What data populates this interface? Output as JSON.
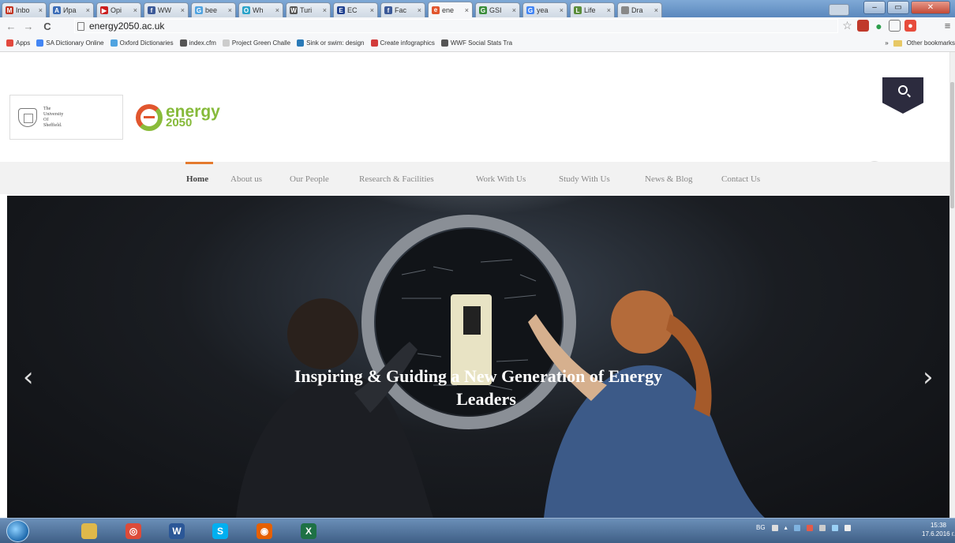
{
  "browser": {
    "tabs": [
      {
        "label": "Inbo",
        "color": "#c23321",
        "glyph": "M"
      },
      {
        "label": "Ира",
        "color": "#3b6cb7",
        "glyph": "A"
      },
      {
        "label": "Opi",
        "color": "#cc1e1e",
        "glyph": "▶"
      },
      {
        "label": "WW",
        "color": "#3b5998",
        "glyph": "f"
      },
      {
        "label": "bee",
        "color": "#4fa3e0",
        "glyph": "G"
      },
      {
        "label": "Wh",
        "color": "#2aa3c9",
        "glyph": "O"
      },
      {
        "label": "Turi",
        "color": "#555555",
        "glyph": "W"
      },
      {
        "label": "EC",
        "color": "#1d3f8f",
        "glyph": "E"
      },
      {
        "label": "Fac",
        "color": "#3b5998",
        "glyph": "f"
      },
      {
        "label": "ene",
        "color": "#e1562e",
        "glyph": "e"
      },
      {
        "label": "GSI",
        "color": "#3a8d3a",
        "glyph": "G"
      },
      {
        "label": "yea",
        "color": "#4285f4",
        "glyph": "G"
      },
      {
        "label": "Life",
        "color": "#5a8d3a",
        "glyph": "L"
      },
      {
        "label": "Dra",
        "color": "#888888",
        "glyph": ""
      }
    ],
    "active_tab_index": 9,
    "url": "energy2050.ac.uk",
    "bookmarks": [
      {
        "label": "Apps",
        "color": "#e2483d"
      },
      {
        "label": "SA Dictionary Online",
        "color": "#4285f4"
      },
      {
        "label": "Oxford Dictionaries",
        "color": "#4fa3e0"
      },
      {
        "label": "index.cfm",
        "color": "#555555"
      },
      {
        "label": "Project Green Challe",
        "color": "#cccccc"
      },
      {
        "label": "Sink or swim: design",
        "color": "#2a7ab8"
      },
      {
        "label": "Create infographics",
        "color": "#d23b3b"
      },
      {
        "label": "WWF Social Stats Tra",
        "color": "#555555"
      }
    ],
    "bookmarks_overflow": "»",
    "other_bookmarks": "Other bookmarks"
  },
  "site": {
    "university_lines": [
      "The",
      "University",
      "Of",
      "Sheffield."
    ],
    "logo_word1": "energy",
    "logo_word2": "2050",
    "twitter_glyph": "y",
    "nav": [
      {
        "label": "Home",
        "active": true
      },
      {
        "label": "About us",
        "active": false
      },
      {
        "label": "Our People",
        "active": false
      },
      {
        "label": "Research & Facilities",
        "active": false
      },
      {
        "label": "Work With Us",
        "active": false
      },
      {
        "label": "Study With Us",
        "active": false
      },
      {
        "label": "News & Blog",
        "active": false
      },
      {
        "label": "Contact Us",
        "active": false
      }
    ],
    "hero": {
      "line1": "Inspiring & Guiding a New Generation of Energy",
      "line2": "Leaders",
      "prev_glyph": "‹",
      "next_glyph": "›"
    }
  },
  "taskbar": {
    "apps": [
      {
        "name": "explorer",
        "color": "#e0b84a",
        "glyph": ""
      },
      {
        "name": "chrome",
        "color": "#dd4b39",
        "glyph": "◎"
      },
      {
        "name": "word",
        "color": "#2b5797",
        "glyph": "W"
      },
      {
        "name": "skype",
        "color": "#00aff0",
        "glyph": "S"
      },
      {
        "name": "firefox",
        "color": "#e66000",
        "glyph": "◉"
      },
      {
        "name": "excel",
        "color": "#1e7145",
        "glyph": "X"
      }
    ],
    "language": "BG",
    "time": "15:38",
    "date": "17.6.2016 г."
  }
}
